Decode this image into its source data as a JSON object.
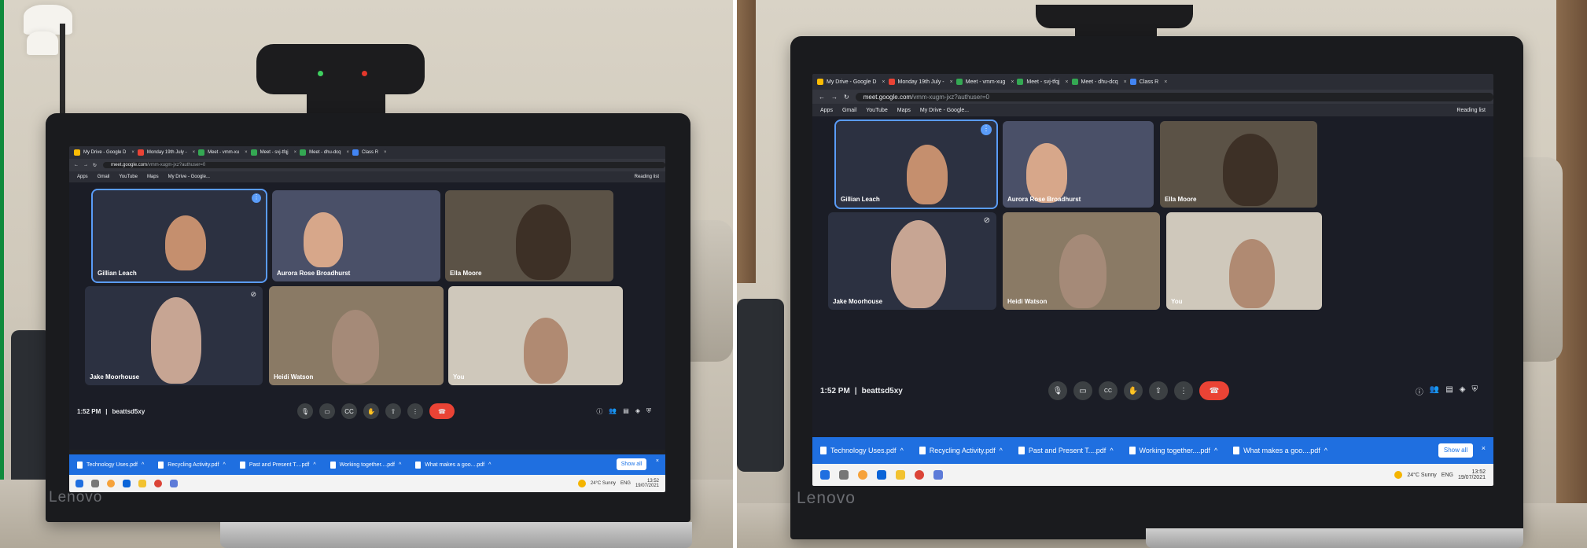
{
  "photos": [
    {
      "brand": "Lenovo",
      "tabs": [
        {
          "label": "My Drive - Google D",
          "color": "#fbbc04"
        },
        {
          "label": "Monday 19th July -",
          "color": "#ea4335"
        },
        {
          "label": "Meet - vmm-xu",
          "color": "#34a853"
        },
        {
          "label": "Meet - svj-tfqj",
          "color": "#34a853"
        },
        {
          "label": "Meet - dhu-dcq",
          "color": "#34a853"
        },
        {
          "label": "Class R",
          "color": "#4285f4"
        }
      ],
      "url_host": "meet.google.com",
      "url_path": "/vmm-xugm-jxz?authuser=0",
      "bookmarks": [
        "Apps",
        "Gmail",
        "YouTube",
        "Maps",
        "My Drive - Google..."
      ],
      "reading_list": "Reading list",
      "participants": [
        "Gillian Leach",
        "Aurora Rose Broadhurst",
        "Ella Moore",
        "Jake Moorhouse",
        "Heidi Watson",
        "You"
      ],
      "time": "1:52 PM",
      "meeting_code": "beattsd5xy",
      "downloads": [
        "Technology Uses.pdf",
        "Recycling Activity.pdf",
        "Past and Present T....pdf",
        "Working together....pdf",
        "What makes a goo....pdf"
      ],
      "show_all": "Show all",
      "weather": "24°C Sunny",
      "language": "ENG",
      "clock_time": "13:52",
      "clock_date": "19/07/2021"
    },
    {
      "brand": "Lenovo",
      "tabs": [
        {
          "label": "My Drive - Google D",
          "color": "#fbbc04"
        },
        {
          "label": "Monday 19th July -",
          "color": "#ea4335"
        },
        {
          "label": "Meet - vmm-xug",
          "color": "#34a853"
        },
        {
          "label": "Meet - svj-tfqj",
          "color": "#34a853"
        },
        {
          "label": "Meet - dhu-dcq",
          "color": "#34a853"
        },
        {
          "label": "Class R",
          "color": "#4285f4"
        }
      ],
      "url_host": "meet.google.com",
      "url_path": "/vmm-xugm-jxz?authuser=0",
      "bookmarks": [
        "Apps",
        "Gmail",
        "YouTube",
        "Maps",
        "My Drive - Google..."
      ],
      "reading_list": "Reading list",
      "participants": [
        "Gillian Leach",
        "Aurora Rose Broadhurst",
        "Ella Moore",
        "Jake Moorhouse",
        "Heidi Watson",
        "You"
      ],
      "time": "1:52 PM",
      "meeting_code": "beattsd5xy",
      "downloads": [
        "Technology Uses.pdf",
        "Recycling Activity.pdf",
        "Past and Present T....pdf",
        "Working together....pdf",
        "What makes a goo....pdf"
      ],
      "show_all": "Show all",
      "weather": "24°C Sunny",
      "language": "ENG",
      "clock_time": "13:52",
      "clock_date": "19/07/2021"
    }
  ],
  "colors": {
    "meet_background": "#1b1d26",
    "active_speaker_outline": "#5a9cf8",
    "end_call": "#ea4335",
    "downloads_bar": "#1f6fe0"
  }
}
